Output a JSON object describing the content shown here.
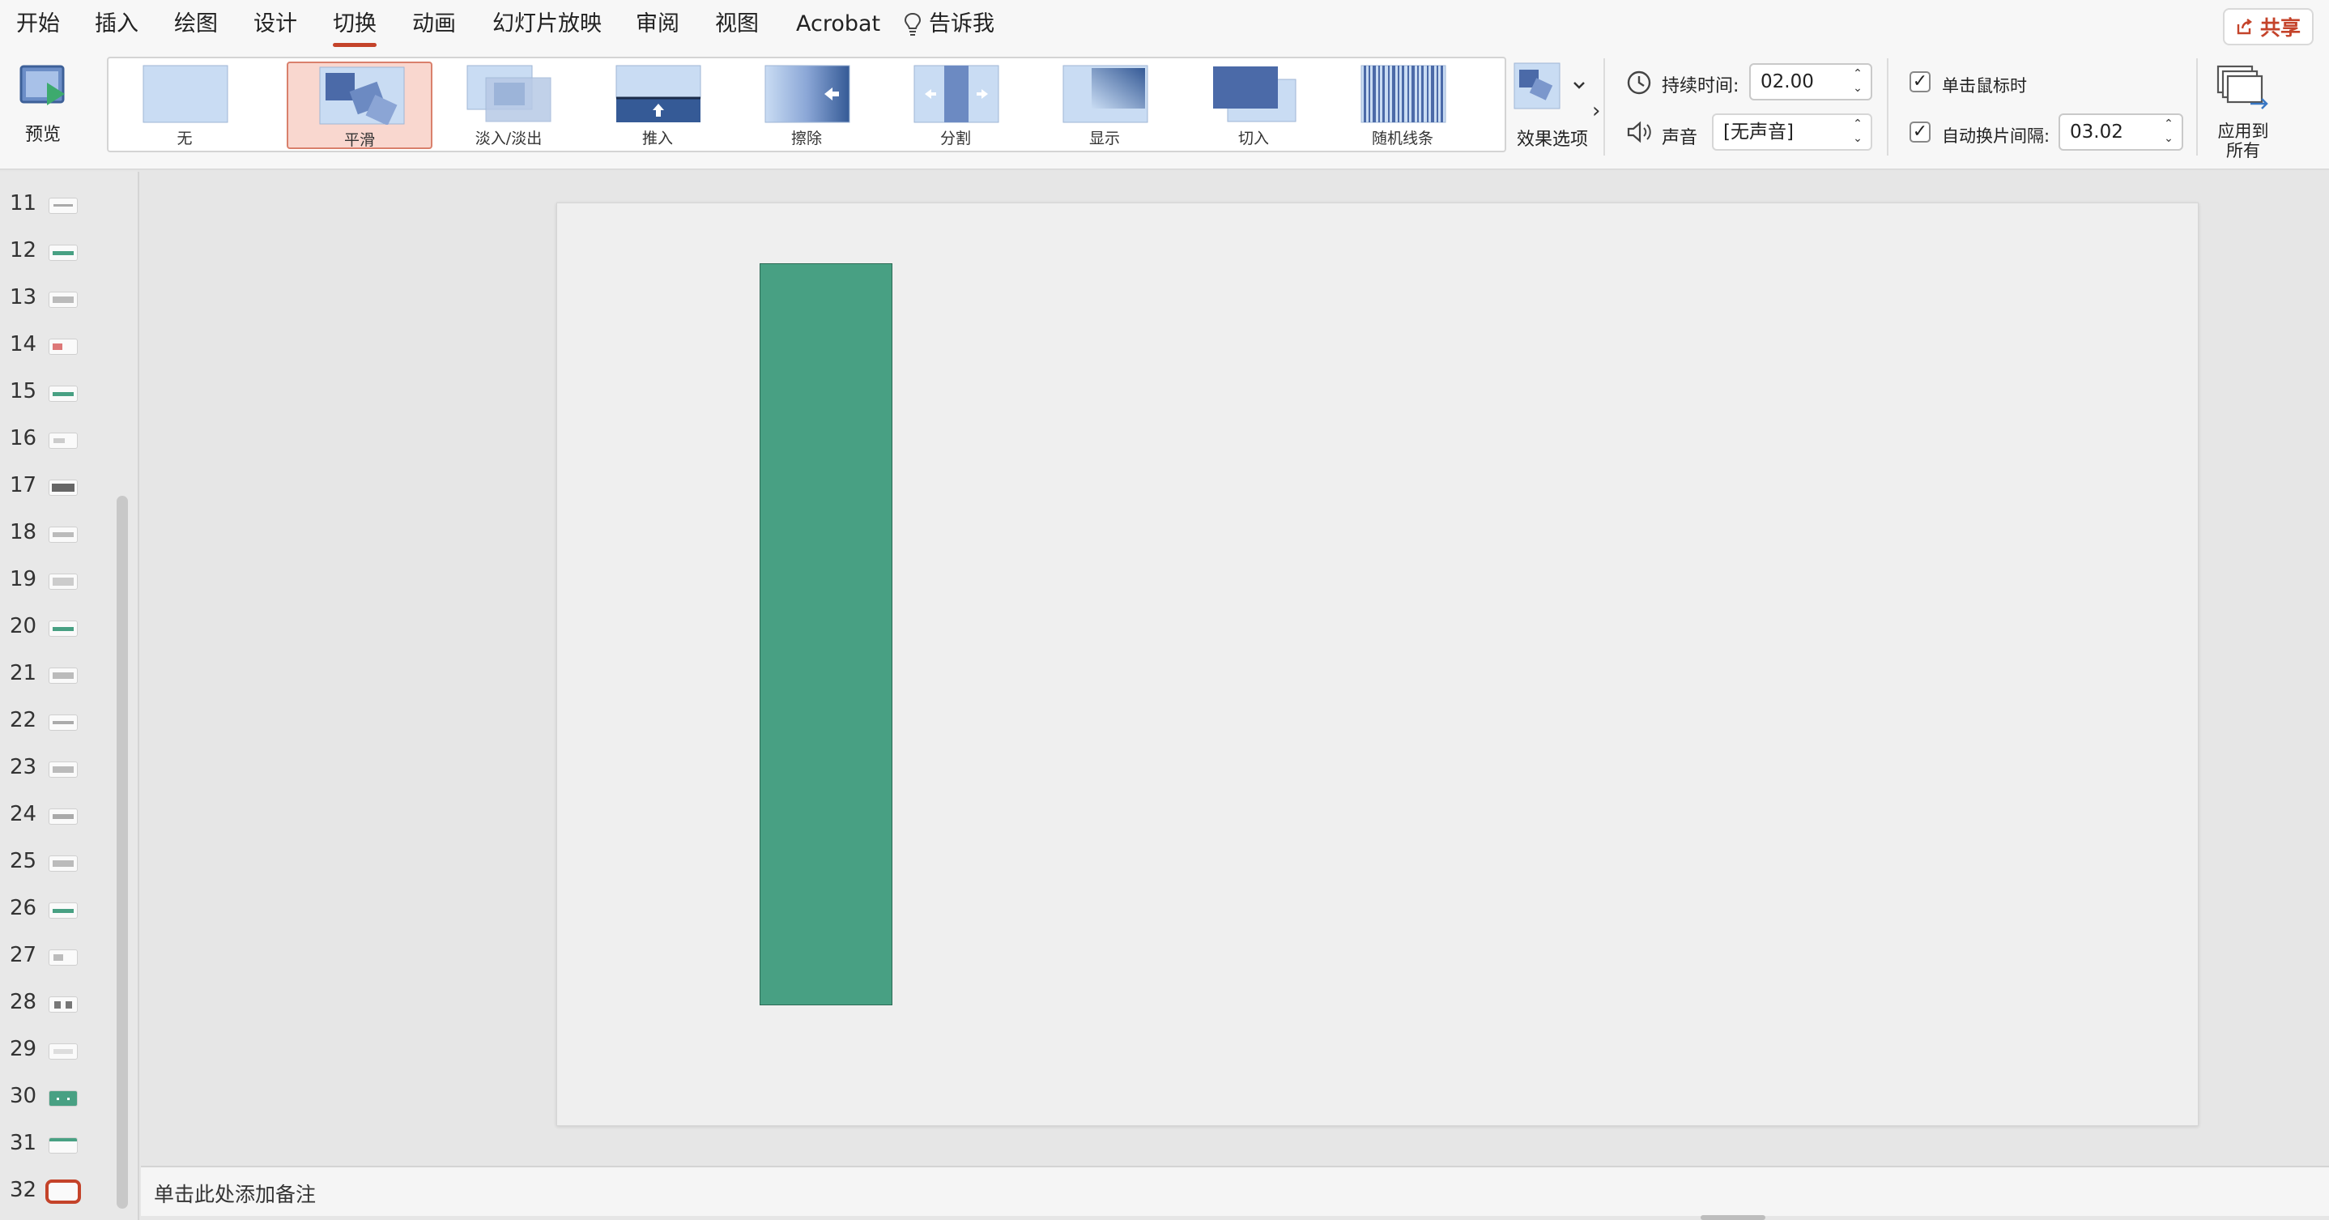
{
  "ribbon_tabs": [
    "开始",
    "插入",
    "绘图",
    "设计",
    "切换",
    "动画",
    "幻灯片放映",
    "审阅",
    "视图",
    "Acrobat"
  ],
  "active_tab": "切换",
  "tell_me": "告诉我",
  "share_label": "共享",
  "preview_label": "预览",
  "transitions": [
    {
      "label": "无",
      "icon": "none-transition-icon"
    },
    {
      "label": "平滑",
      "icon": "morph-transition-icon"
    },
    {
      "label": "淡入/淡出",
      "icon": "fade-transition-icon"
    },
    {
      "label": "推入",
      "icon": "push-transition-icon"
    },
    {
      "label": "擦除",
      "icon": "wipe-transition-icon"
    },
    {
      "label": "分割",
      "icon": "split-transition-icon"
    },
    {
      "label": "显示",
      "icon": "reveal-transition-icon"
    },
    {
      "label": "切入",
      "icon": "cut-transition-icon"
    },
    {
      "label": "随机线条",
      "icon": "random-bars-transition-icon"
    }
  ],
  "selected_transition": "平滑",
  "effect_options_label": "效果选项",
  "duration": {
    "label": "持续时间:",
    "value": "02.00"
  },
  "sound": {
    "label": "声音",
    "value": "[无声音]"
  },
  "on_click": {
    "label": "单击鼠标时",
    "checked": true
  },
  "auto_advance": {
    "label": "自动换片间隔:",
    "value": "03.02",
    "checked": true
  },
  "apply_all": {
    "line1": "应用到",
    "line2": "所有"
  },
  "slides": [
    {
      "num": "11"
    },
    {
      "num": "12"
    },
    {
      "num": "13"
    },
    {
      "num": "14"
    },
    {
      "num": "15"
    },
    {
      "num": "16"
    },
    {
      "num": "17"
    },
    {
      "num": "18"
    },
    {
      "num": "19"
    },
    {
      "num": "20"
    },
    {
      "num": "21"
    },
    {
      "num": "22"
    },
    {
      "num": "23"
    },
    {
      "num": "24"
    },
    {
      "num": "25"
    },
    {
      "num": "26"
    },
    {
      "num": "27"
    },
    {
      "num": "28"
    },
    {
      "num": "29"
    },
    {
      "num": "30"
    },
    {
      "num": "31"
    },
    {
      "num": "32"
    }
  ],
  "current_slide": "32",
  "slide_shape_color": "#48a083",
  "accent_color": "#c4432a",
  "notes_placeholder": "单击此处添加备注"
}
